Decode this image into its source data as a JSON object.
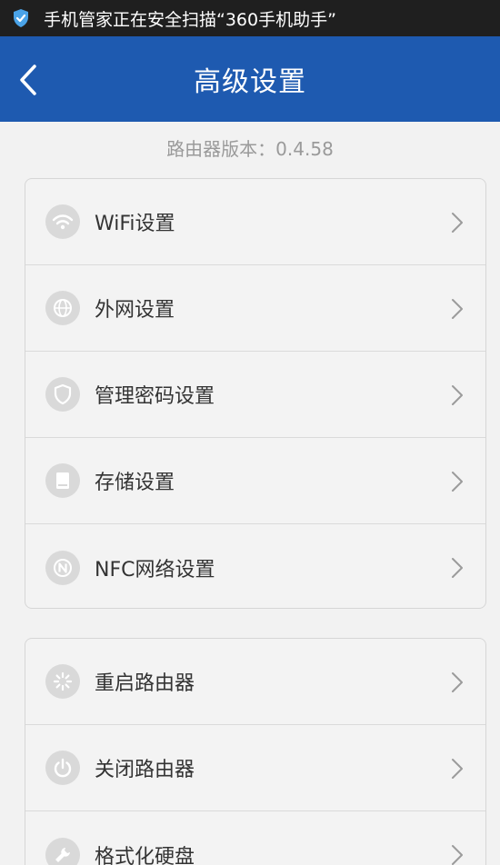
{
  "status_bar": {
    "notification": "手机管家正在安全扫描“360手机助手”",
    "shield_icon": "shield-check-icon"
  },
  "header": {
    "title": "高级设置",
    "back_icon": "chevron-left-icon"
  },
  "version_text": "路由器版本：0.4.58",
  "groups": [
    {
      "items": [
        {
          "label": "WiFi设置",
          "icon": "wifi-icon"
        },
        {
          "label": "外网设置",
          "icon": "globe-icon"
        },
        {
          "label": "管理密码设置",
          "icon": "shield-icon"
        },
        {
          "label": "存储设置",
          "icon": "storage-icon"
        },
        {
          "label": "NFC网络设置",
          "icon": "nfc-icon"
        }
      ]
    },
    {
      "items": [
        {
          "label": "重启路由器",
          "icon": "restart-icon"
        },
        {
          "label": "关闭路由器",
          "icon": "power-icon"
        },
        {
          "label": "格式化硬盘",
          "icon": "wrench-icon"
        }
      ]
    }
  ],
  "colors": {
    "header_bg": "#1e5ab0",
    "status_bg": "#1f1f1f",
    "page_bg": "#f2f2f2"
  }
}
